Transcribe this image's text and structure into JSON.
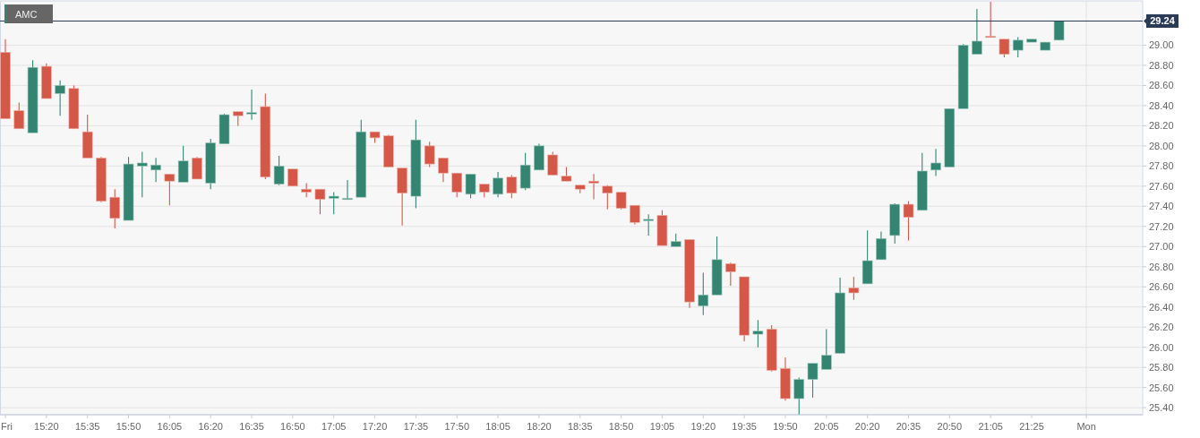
{
  "symbol_tag": {
    "label": "AMC"
  },
  "chart": {
    "chart_data": {
      "type": "candlestick",
      "categories": [
        "Fri",
        null,
        null,
        "15:20",
        null,
        null,
        "15:35",
        null,
        null,
        "15:50",
        null,
        null,
        "16:05",
        null,
        null,
        "16:20",
        null,
        null,
        "16:35",
        null,
        null,
        "16:50",
        null,
        null,
        "17:05",
        null,
        null,
        "17:20",
        null,
        null,
        "17:35",
        null,
        null,
        "17:50",
        null,
        null,
        "18:05",
        null,
        null,
        "18:20",
        null,
        null,
        "18:35",
        null,
        null,
        "18:50",
        null,
        null,
        "19:05",
        null,
        null,
        "19:20",
        null,
        null,
        "19:35",
        null,
        null,
        "19:50",
        null,
        null,
        "20:05",
        null,
        null,
        "20:20",
        null,
        null,
        "20:35",
        null,
        null,
        "20:50",
        null,
        null,
        "21:05",
        null,
        null,
        "21:25",
        null,
        null,
        null,
        "Mon"
      ],
      "ohlc": [
        [
          28.93,
          29.06,
          28.27,
          28.27
        ],
        [
          28.35,
          28.43,
          28.17,
          28.17
        ],
        [
          28.13,
          28.85,
          28.13,
          28.78
        ],
        [
          28.79,
          28.82,
          28.47,
          28.47
        ],
        [
          28.52,
          28.65,
          28.3,
          28.6
        ],
        [
          28.57,
          28.6,
          28.17,
          28.17
        ],
        [
          28.14,
          28.31,
          27.88,
          27.88
        ],
        [
          27.88,
          27.89,
          27.44,
          27.45
        ],
        [
          27.49,
          27.57,
          27.18,
          27.28
        ],
        [
          27.26,
          27.89,
          27.26,
          27.82
        ],
        [
          27.8,
          27.94,
          27.49,
          27.83
        ],
        [
          27.76,
          27.88,
          27.64,
          27.81
        ],
        [
          27.72,
          27.72,
          27.41,
          27.65
        ],
        [
          27.64,
          28.0,
          27.64,
          27.85
        ],
        [
          27.88,
          27.89,
          27.67,
          27.67
        ],
        [
          27.63,
          28.07,
          27.57,
          28.03
        ],
        [
          28.02,
          28.32,
          28.02,
          28.31
        ],
        [
          28.34,
          28.34,
          28.2,
          28.3
        ],
        [
          28.32,
          28.56,
          28.26,
          28.33
        ],
        [
          28.39,
          28.52,
          27.67,
          27.69
        ],
        [
          27.62,
          27.9,
          27.61,
          27.8
        ],
        [
          27.77,
          27.77,
          27.6,
          27.6
        ],
        [
          27.57,
          27.63,
          27.49,
          27.54
        ],
        [
          27.57,
          27.57,
          27.32,
          27.47
        ],
        [
          27.48,
          27.54,
          27.32,
          27.5
        ],
        [
          27.47,
          27.66,
          27.47,
          27.48
        ],
        [
          27.49,
          28.26,
          27.49,
          28.14
        ],
        [
          28.14,
          28.14,
          28.03,
          28.08
        ],
        [
          28.1,
          28.11,
          27.79,
          27.79
        ],
        [
          27.78,
          27.78,
          27.21,
          27.53
        ],
        [
          27.5,
          28.26,
          27.38,
          28.06
        ],
        [
          28.0,
          28.04,
          27.79,
          27.82
        ],
        [
          27.88,
          27.88,
          27.64,
          27.73
        ],
        [
          27.73,
          27.73,
          27.49,
          27.54
        ],
        [
          27.52,
          27.72,
          27.48,
          27.72
        ],
        [
          27.62,
          27.62,
          27.49,
          27.54
        ],
        [
          27.52,
          27.74,
          27.49,
          27.68
        ],
        [
          27.69,
          27.71,
          27.48,
          27.53
        ],
        [
          27.58,
          27.93,
          27.56,
          27.81
        ],
        [
          27.76,
          28.02,
          27.76,
          28.0
        ],
        [
          27.91,
          27.94,
          27.71,
          27.71
        ],
        [
          27.7,
          27.79,
          27.65,
          27.65
        ],
        [
          27.61,
          27.61,
          27.53,
          27.57
        ],
        [
          27.65,
          27.72,
          27.47,
          27.63
        ],
        [
          27.6,
          27.61,
          27.37,
          27.53
        ],
        [
          27.54,
          27.54,
          27.37,
          27.38
        ],
        [
          27.41,
          27.41,
          27.22,
          27.24
        ],
        [
          27.26,
          27.32,
          27.11,
          27.27
        ],
        [
          27.31,
          27.36,
          27.01,
          27.01
        ],
        [
          27.0,
          27.13,
          27.0,
          27.05
        ],
        [
          27.07,
          27.07,
          26.39,
          26.45
        ],
        [
          26.41,
          26.74,
          26.32,
          26.52
        ],
        [
          26.52,
          27.1,
          26.52,
          26.87
        ],
        [
          26.83,
          26.84,
          26.61,
          26.75
        ],
        [
          26.7,
          26.7,
          26.06,
          26.12
        ],
        [
          26.13,
          26.27,
          26.0,
          26.16
        ],
        [
          26.18,
          26.22,
          25.76,
          25.77
        ],
        [
          25.79,
          25.9,
          25.47,
          25.49
        ],
        [
          25.49,
          25.7,
          25.33,
          25.68
        ],
        [
          25.68,
          25.84,
          25.5,
          25.84
        ],
        [
          25.78,
          26.18,
          25.78,
          25.92
        ],
        [
          25.94,
          26.69,
          25.94,
          26.54
        ],
        [
          26.59,
          26.7,
          26.47,
          26.54
        ],
        [
          26.63,
          27.16,
          26.63,
          26.86
        ],
        [
          26.87,
          27.15,
          26.87,
          27.08
        ],
        [
          27.11,
          27.43,
          27.03,
          27.42
        ],
        [
          27.42,
          27.45,
          27.06,
          27.29
        ],
        [
          27.36,
          27.93,
          27.36,
          27.75
        ],
        [
          27.76,
          27.97,
          27.7,
          27.83
        ],
        [
          27.79,
          28.37,
          27.79,
          28.37
        ],
        [
          28.37,
          29.01,
          28.37,
          29.0
        ],
        [
          28.91,
          29.36,
          28.91,
          29.04
        ],
        [
          29.09,
          29.43,
          29.08,
          29.08
        ],
        [
          29.06,
          29.06,
          28.88,
          28.91
        ],
        [
          28.95,
          29.08,
          28.88,
          29.05
        ],
        [
          29.03,
          29.06,
          29.03,
          29.06
        ],
        [
          28.95,
          29.03,
          28.95,
          29.03
        ],
        [
          29.05,
          29.24,
          29.05,
          29.24
        ],
        null,
        null
      ],
      "ylim": [
        25.33,
        29.44
      ],
      "yticks": [
        {
          "value": 29.0,
          "label": "29.00"
        },
        {
          "value": 28.8,
          "label": "28.80"
        },
        {
          "value": 28.6,
          "label": "28.60"
        },
        {
          "value": 28.4,
          "label": "28.40"
        },
        {
          "value": 28.2,
          "label": "28.20"
        },
        {
          "value": 28.0,
          "label": "28.00"
        },
        {
          "value": 27.8,
          "label": "27.80"
        },
        {
          "value": 27.6,
          "label": "27.60"
        },
        {
          "value": 27.4,
          "label": "27.40"
        },
        {
          "value": 27.2,
          "label": "27.20"
        },
        {
          "value": 27.0,
          "label": "27.00"
        },
        {
          "value": 26.8,
          "label": "26.80"
        },
        {
          "value": 26.6,
          "label": "26.60"
        },
        {
          "value": 26.4,
          "label": "26.40"
        },
        {
          "value": 26.2,
          "label": "26.20"
        },
        {
          "value": 26.0,
          "label": "26.00"
        },
        {
          "value": 25.8,
          "label": "25.80"
        },
        {
          "value": 25.6,
          "label": "25.60"
        },
        {
          "value": 25.4,
          "label": "25.40"
        }
      ],
      "grid": true,
      "ref_lines": [
        {
          "axis": "y",
          "value": 29.24,
          "label": "29.24"
        }
      ]
    }
  }
}
